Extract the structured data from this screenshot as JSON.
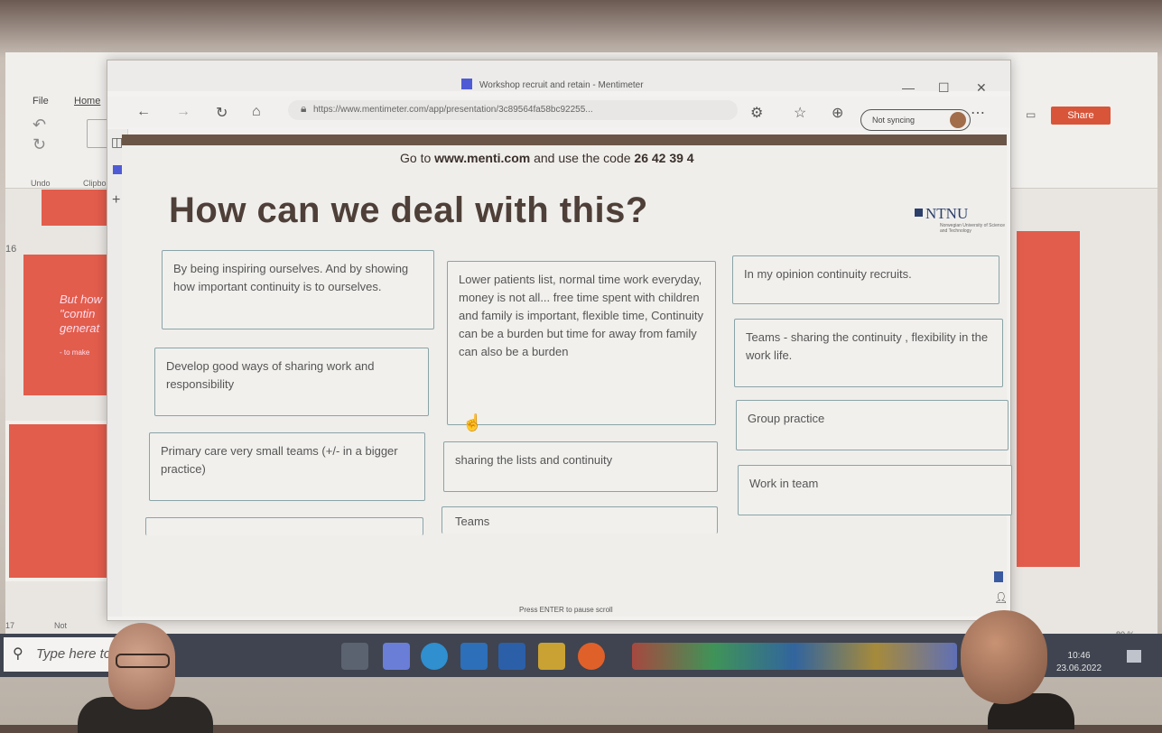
{
  "powerpoint": {
    "tabs": [
      "File",
      "Home"
    ],
    "groups": [
      "Undo",
      "Clipboard"
    ],
    "share_label": "Share",
    "slide_numbers": [
      "16",
      "17"
    ],
    "thumbnail_text": "But how \"contin generat",
    "thumbnail_sub": "- to make",
    "status_left": "Not",
    "zoom": "80 %"
  },
  "browser": {
    "title": "Workshop recruit and retain - Mentimeter",
    "url": "https://www.mentimeter.com/app/presentation/3c89564fa58bc92255...",
    "sync_label": "Not syncing",
    "window_controls": [
      "—",
      "☐",
      "✕"
    ]
  },
  "slide": {
    "join_prefix": "Go to ",
    "join_url": "www.menti.com",
    "join_middle": " and use the code ",
    "join_code": "26 42 39 4",
    "title": "How can we deal with this?",
    "logo": "NTNU",
    "logo_sub": "Norwegian University of Science and Technology",
    "footer": "Press ENTER to pause scroll",
    "responses": [
      "By being inspiring ourselves. And by showing how important continuity is to ourselves.",
      "Develop good ways of sharing work and responsibility",
      "Primary care very small teams (+/- in a bigger practice)",
      "Lower patients list, normal time work everyday, money is not all... free time spent with children and family is important, flexible time, Continuity can be a burden but time for away from family can also be a burden",
      "sharing the lists and continuity",
      "Teams",
      "In my opinion continuity recruits.",
      "Teams - sharing the continuity , flexibility in the work life.",
      "Group practice",
      "Work in team"
    ]
  },
  "taskbar": {
    "search_placeholder": "Type here to",
    "time": "10:46",
    "date": "23.06.2022"
  },
  "colors": {
    "ppt_accent": "#e25d4c",
    "slide_title": "#4e3f38",
    "card_border": "#8aa4a8",
    "taskbar": "#3f4450"
  }
}
